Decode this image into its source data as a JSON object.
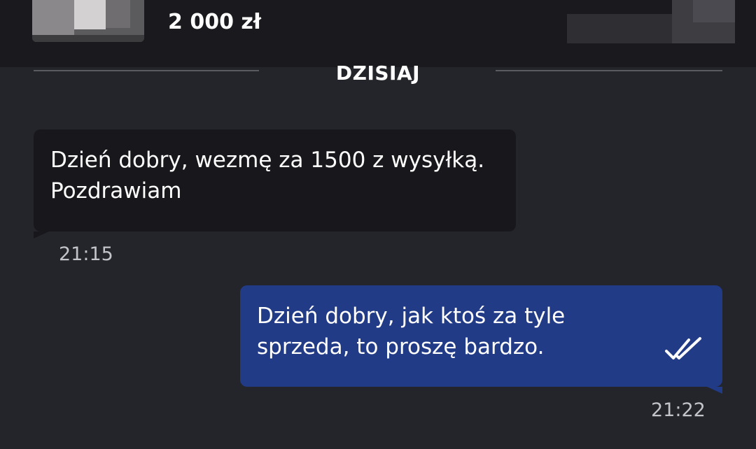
{
  "listing": {
    "price": "2 000 zł"
  },
  "chat": {
    "date_separator": "DZISIAJ",
    "messages": [
      {
        "direction": "incoming",
        "lines": [
          "Dzień dobry, wezmę za 1500 z wysyłką.",
          "Pozdrawiam"
        ],
        "time": "21:15"
      },
      {
        "direction": "outgoing",
        "lines": [
          "Dzień dobry, jak ktoś za tyle",
          "sprzeda, to proszę bardzo."
        ],
        "time": "21:22",
        "status_icon": "double-check-icon"
      }
    ]
  },
  "colors": {
    "background": "#24252a",
    "header": "#1a1a1e",
    "incoming_bubble": "#18181c",
    "outgoing_bubble": "#223b86",
    "timestamp": "#c3c4c9"
  }
}
